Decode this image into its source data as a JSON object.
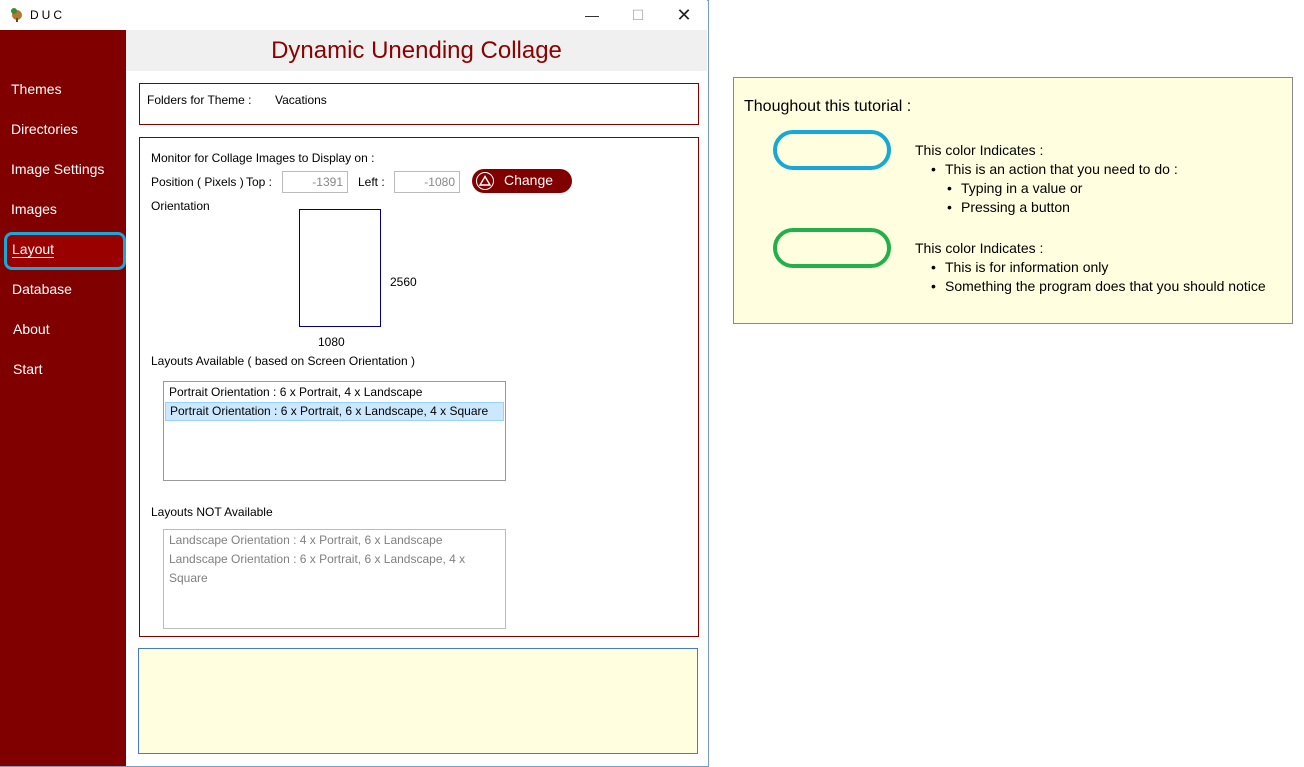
{
  "window": {
    "app_title": "DUC",
    "header_title": "Dynamic Unending Collage",
    "minimize_glyph": "—",
    "maximize_glyph": "☐",
    "close_glyph": "✕"
  },
  "sidebar": {
    "items": [
      {
        "label": "Themes"
      },
      {
        "label": "Directories"
      },
      {
        "label": "Image Settings"
      },
      {
        "label": "Images"
      },
      {
        "label": "Layout",
        "selected": true
      },
      {
        "label": "Database"
      },
      {
        "label": "About"
      },
      {
        "label": "Start"
      }
    ]
  },
  "theme": {
    "label": "Folders for Theme :",
    "value": "Vacations"
  },
  "monitor": {
    "heading": "Monitor for Collage Images to Display on :",
    "position_label": "Position ( Pixels )",
    "top_label": "Top :",
    "top_value": "-1391",
    "left_label": "Left :",
    "left_value": "-1080",
    "change_label": "Change",
    "orientation_label": "Orientation",
    "height_value": "2560",
    "width_value": "1080"
  },
  "layouts": {
    "available_label": "Layouts Available ( based on Screen Orientation )",
    "available": [
      "Portrait Orientation : 6 x Portrait, 4 x Landscape",
      "Portrait Orientation : 6 x Portrait, 6 x Landscape, 4 x Square"
    ],
    "selected_index": 1,
    "not_available_label": "Layouts NOT Available",
    "not_available": [
      "Landscape Orientation : 4 x Portrait, 6 x Landscape",
      "Landscape Orientation : 6 x Portrait, 6 x Landscape, 4 x Square"
    ]
  },
  "legend": {
    "title": "Thoughout this tutorial :",
    "action": {
      "heading": "This color Indicates :",
      "line1": "This is an action that you need to do :",
      "sub1": "Typing in a value or",
      "sub2": "Pressing a button",
      "color": "#18a8d8"
    },
    "info": {
      "heading": "This color Indicates :",
      "line1": "This is for information only",
      "line2": "Something the program does that you should notice",
      "color": "#22b04a"
    }
  },
  "colors": {
    "sidebar": "#800000",
    "accent": "#8b0000",
    "info_background": "#ffffe0"
  }
}
